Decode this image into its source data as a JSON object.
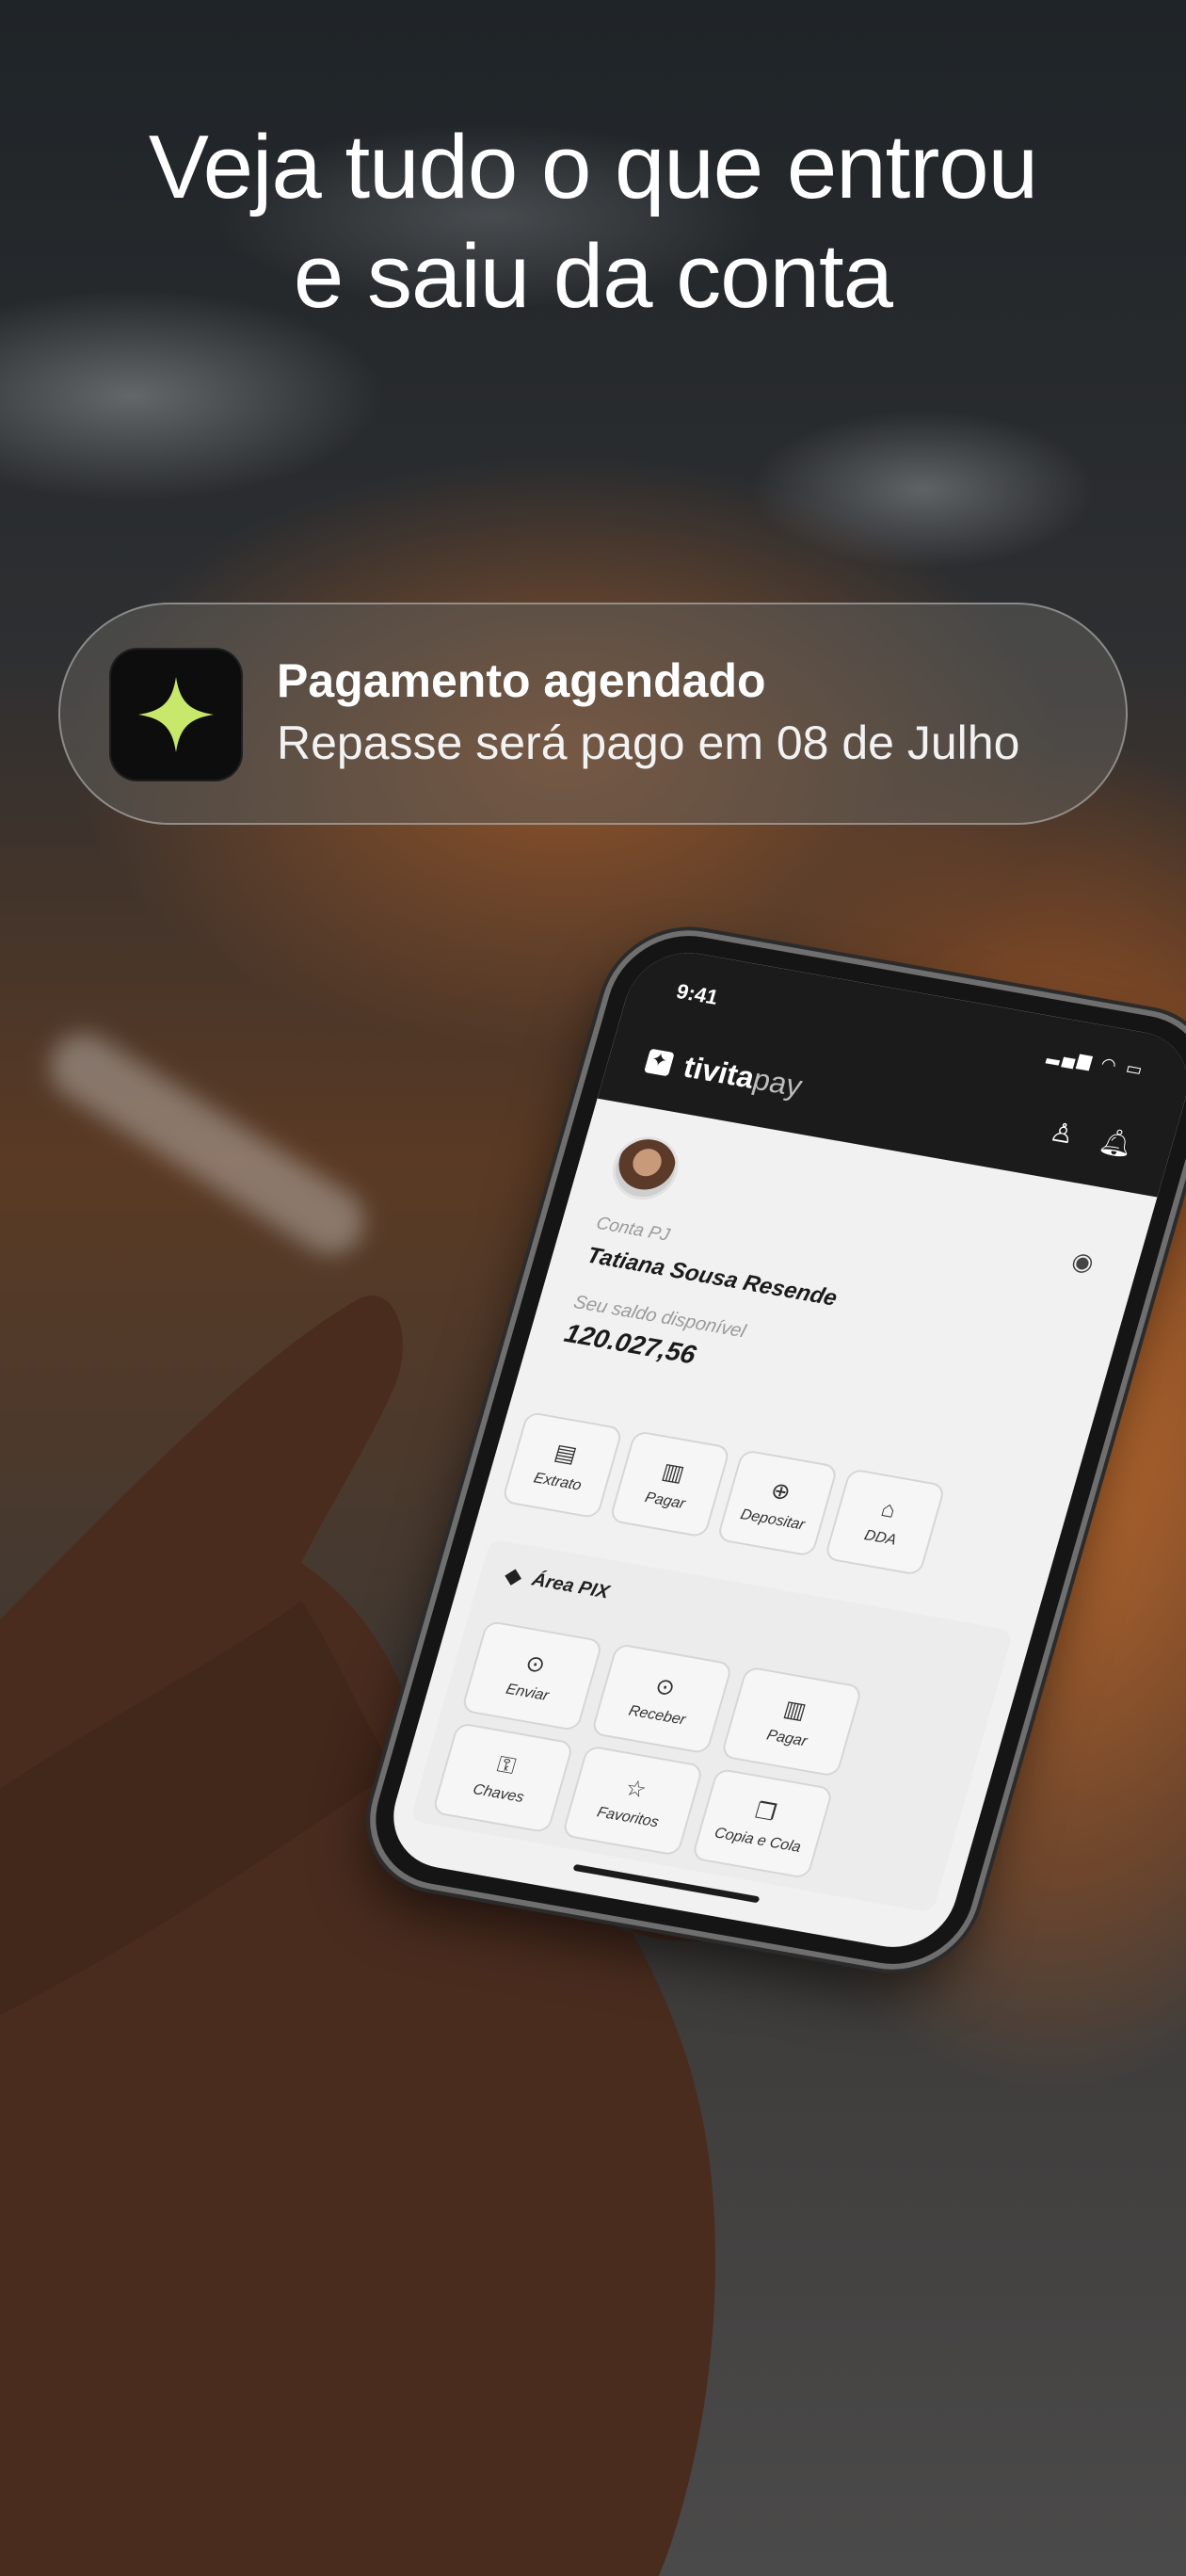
{
  "headline": {
    "line1": "Veja tudo o que entrou",
    "line2": "e saiu da conta"
  },
  "notification": {
    "icon": "sparkle-icon",
    "accent": "#c7e86a",
    "title": "Pagamento agendado",
    "text": "Repasse será pago em 08 de Julho"
  },
  "phone": {
    "status_time": "9:41",
    "brand_bold": "tivita",
    "brand_light": "pay",
    "account_type": "Conta PJ",
    "account_name": "Tatiana Sousa Resende",
    "balance_label": "Seu saldo disponível",
    "balance_value": "120.027,56",
    "actions": [
      {
        "label": "Extrato",
        "icon": "receipt-icon"
      },
      {
        "label": "Pagar",
        "icon": "barcode-icon"
      },
      {
        "label": "Depositar",
        "icon": "deposit-icon"
      },
      {
        "label": "DDA",
        "icon": "bank-icon"
      }
    ],
    "pix_title": "Área PIX",
    "pix_items": [
      {
        "label": "Enviar",
        "icon": "send-money-icon"
      },
      {
        "label": "Receber",
        "icon": "receive-money-icon"
      },
      {
        "label": "Pagar",
        "icon": "barcode-icon"
      },
      {
        "label": "Chaves",
        "icon": "key-icon"
      },
      {
        "label": "Favoritos",
        "icon": "star-icon"
      },
      {
        "label": "Copia e Cola",
        "icon": "copy-icon"
      }
    ]
  }
}
